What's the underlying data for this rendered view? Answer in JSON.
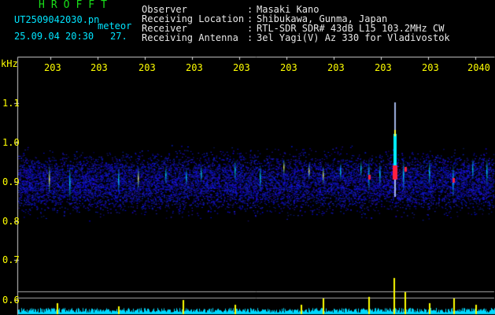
{
  "header": {
    "brand": "HROFFT",
    "filename": "UT2509042030.pn",
    "datetime": "25.09.04 20:30",
    "meteor_label": "meteor",
    "meteor_count": "27."
  },
  "info": [
    {
      "label": "Observer",
      "value": "Masaki Kano"
    },
    {
      "label": "Receiving Location",
      "value": "Shibukawa, Gunma, Japan"
    },
    {
      "label": "Receiver",
      "value": "RTL-SDR SDR# 43dB L15 103.2MHz CW"
    },
    {
      "label": "Receiving Antenna",
      "value": "3el Yagi(V) Az 330 for Vladivostok"
    }
  ],
  "info_separator": ":",
  "axis": {
    "unit": "kHz",
    "y_ticks": [
      "1.1",
      "1.0",
      "0.9",
      "0.8",
      "0.7",
      "0.6"
    ],
    "x_ticks": [
      "203",
      "203",
      "203",
      "203",
      "203",
      "203",
      "203",
      "203",
      "203",
      "2040"
    ]
  },
  "colors": {
    "brand": "#19e019",
    "info_text": "#e8e8e8",
    "file_text": "#00e5ff",
    "tick_text": "#ffff00",
    "meteor_echo": "#ff2040",
    "noise": "#1a1ad0",
    "baseline": "#00d8ff"
  }
}
